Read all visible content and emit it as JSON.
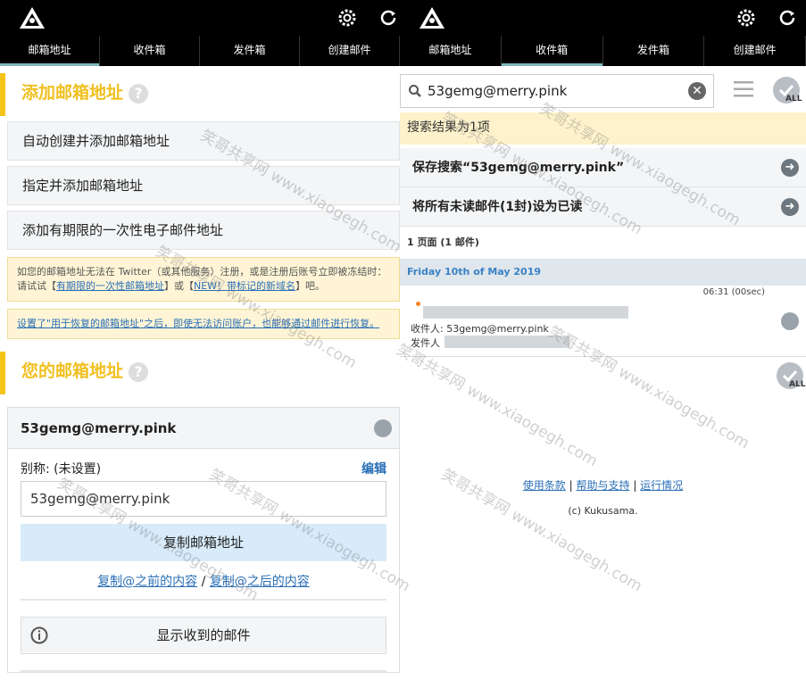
{
  "nav": {
    "tabs": [
      "邮箱地址",
      "收件箱",
      "发件箱",
      "创建邮件"
    ]
  },
  "left": {
    "add_section_title": "添加邮箱地址",
    "buttons": [
      "自动创建并添加邮箱地址",
      "指定并添加邮箱地址",
      "添加有期限的一次性电子邮件地址"
    ],
    "note1": {
      "text_a": "如您的邮箱地址无法在 Twitter（或其他服务）注册，或是注册后账号立即被冻结时：请试试【",
      "link_a": "有期限的一次性邮箱地址",
      "text_b": "】或【",
      "link_b": "NEW！带标记的新域名",
      "text_c": "】吧。"
    },
    "note2_link": "设置了\"用于恢复的邮箱地址\"之后，即使无法访问账户，也能够通过邮件进行恢复。",
    "your_section_title": "您的邮箱地址",
    "card": {
      "address": "53gemg@merry.pink",
      "alias_label": "别称: (未设置)",
      "edit": "编辑",
      "input_value": "53gemg@merry.pink",
      "copy_button": "复制邮箱地址",
      "copy_before": "复制@之前的内容",
      "separator": " / ",
      "copy_after": "复制@之后的内容",
      "show_mail": "显示收到的邮件"
    }
  },
  "right": {
    "search_value": "53gemg@merry.pink",
    "all_label": "ALL",
    "result_banner": "搜索结果为1项",
    "save_search": "保存搜索“53gemg@merry.pink”",
    "mark_read": "将所有未读邮件(1封)设为已读",
    "page_info": "1 页面 (1 邮件)",
    "date_header": "Friday 10th of May 2019",
    "mail": {
      "time": "06:31 (00sec)",
      "to": "收件人: 53gemg@merry.pink",
      "from": "发件人"
    },
    "footer": {
      "terms": "使用条款",
      "help": "帮助与支持",
      "status": "运行情况",
      "sep": " | ",
      "copyright": "(c) Kukusama."
    }
  },
  "watermark": "笑哥共享网 www.xiaogegh.com",
  "colors": {
    "accent_yellow": "#f0c020",
    "link": "#2a6fb6",
    "tab_active": "#7fb8bd"
  }
}
